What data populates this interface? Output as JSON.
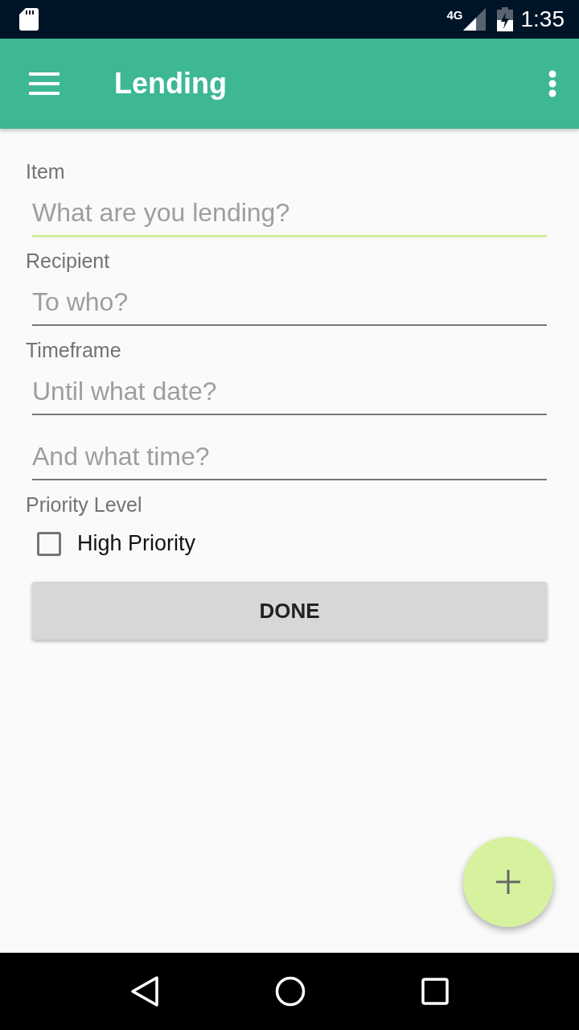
{
  "status_bar": {
    "network": "4G",
    "time": "1:35"
  },
  "app_bar": {
    "title": "Lending"
  },
  "sections": [
    {
      "label": "Item",
      "fields": [
        {
          "placeholder": "What are you lending?",
          "focused": true
        }
      ]
    },
    {
      "label": "Recipient",
      "fields": [
        {
          "placeholder": "To who?",
          "focused": false
        }
      ]
    },
    {
      "label": "Timeframe",
      "fields": [
        {
          "placeholder": "Until what date?",
          "focused": false
        },
        {
          "placeholder": "And what time?",
          "focused": false
        }
      ]
    }
  ],
  "priority": {
    "label": "Priority Level",
    "checkbox": {
      "label": "High Priority",
      "checked": false
    }
  },
  "button": {
    "label": "DONE"
  }
}
